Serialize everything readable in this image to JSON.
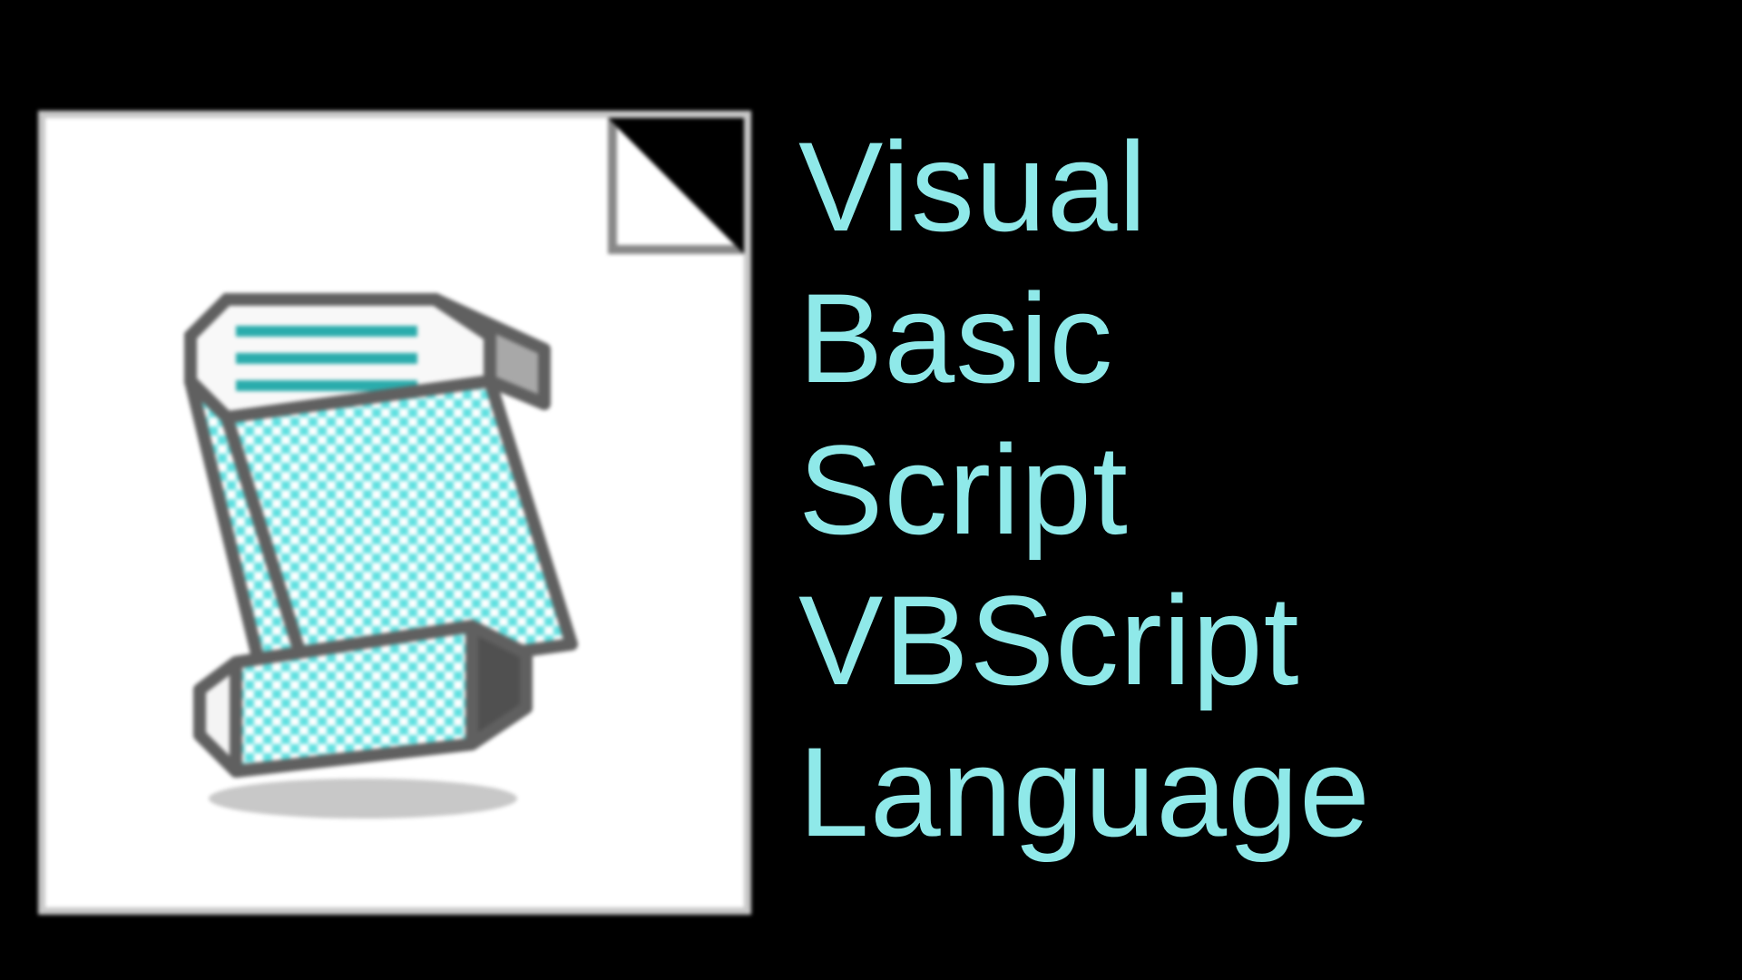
{
  "title": {
    "line1": "Visual",
    "line2": "Basic",
    "line3": "Script",
    "line4": "VBScript",
    "line5": "Language"
  },
  "colors": {
    "text": "#8fe9e9",
    "bg": "#000000",
    "page": "#ffffff",
    "accent": "#5fe0e0"
  },
  "icon": {
    "name": "vbscript-file"
  }
}
